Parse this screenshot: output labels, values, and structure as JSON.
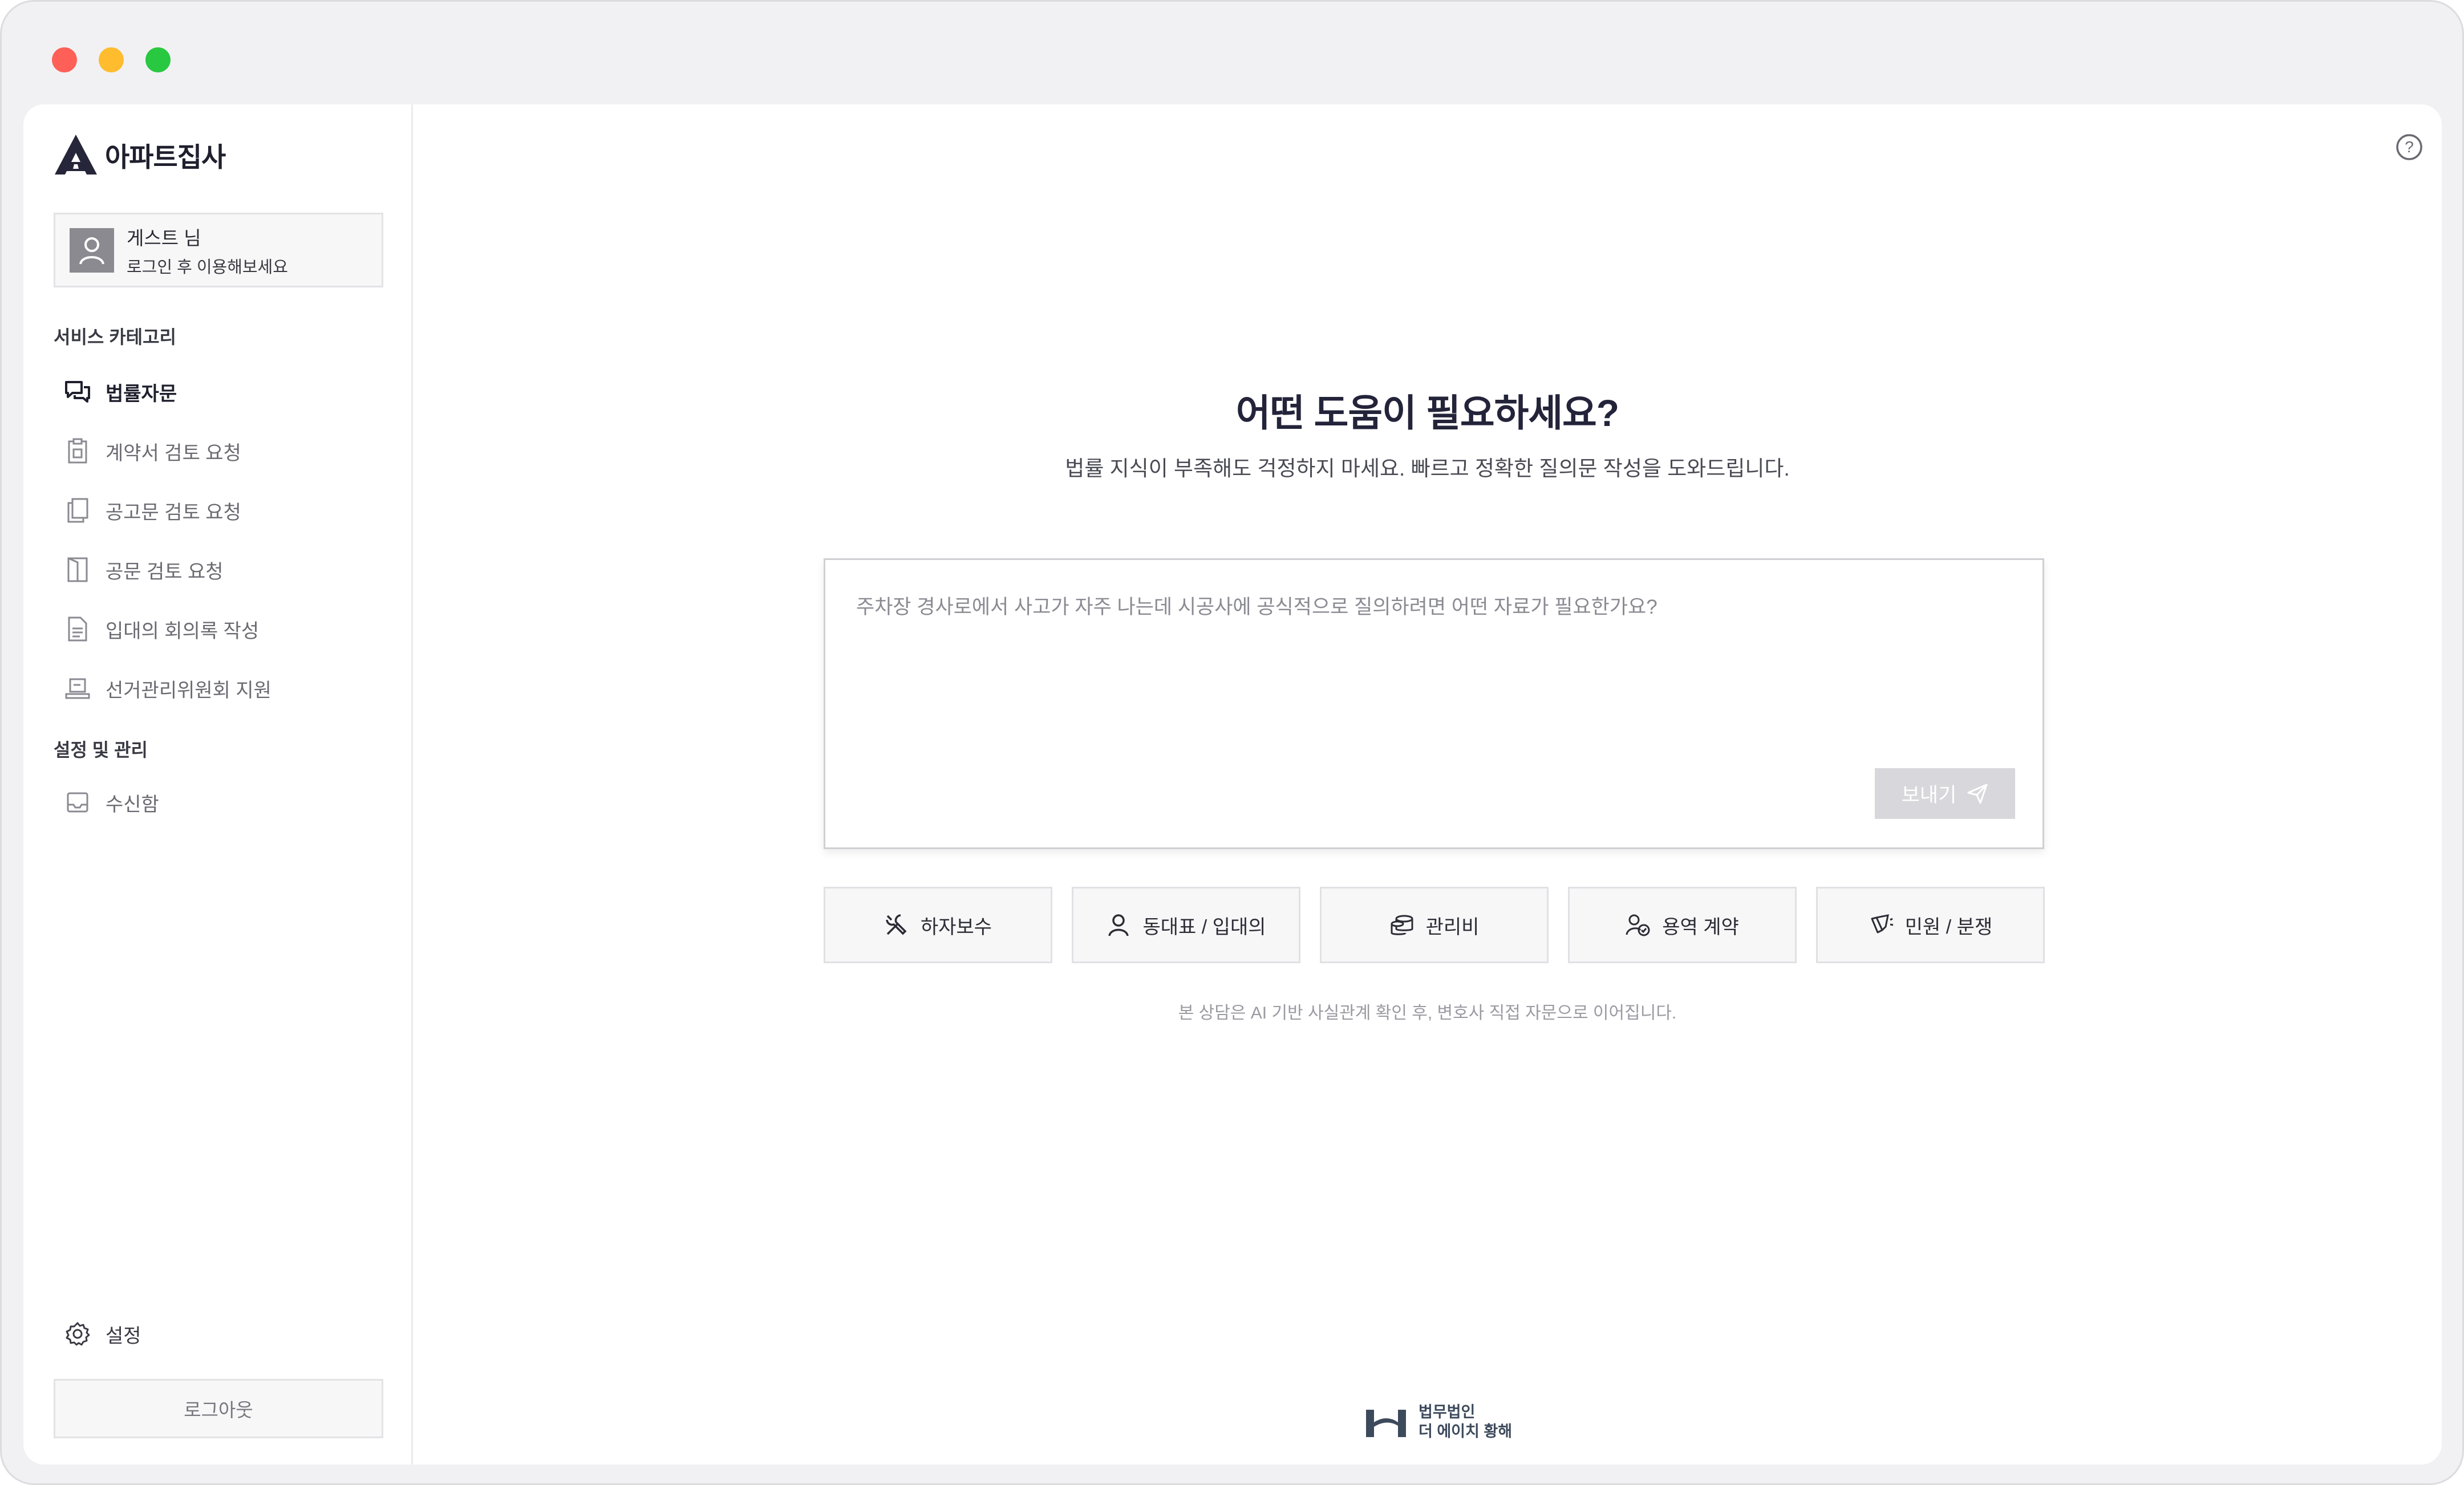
{
  "app": {
    "name": "아파트집사"
  },
  "user": {
    "name": "게스트 님",
    "subtitle": "로그인 후 이용해보세요"
  },
  "sidebar": {
    "section_services": "서비스 카테고리",
    "items": [
      {
        "label": "법률자문",
        "icon": "chat-bubbles-icon",
        "active": true
      },
      {
        "label": "계약서 검토 요청",
        "icon": "clipboard-icon"
      },
      {
        "label": "공고문 검토 요청",
        "icon": "copy-docs-icon"
      },
      {
        "label": "공문 검토 요청",
        "icon": "door-doc-icon"
      },
      {
        "label": "입대의 회의록 작성",
        "icon": "document-icon"
      },
      {
        "label": "선거관리위원회 지원",
        "icon": "ballot-icon"
      }
    ],
    "section_settings": "설정 및 관리",
    "settings_items": [
      {
        "label": "수신함",
        "icon": "inbox-icon"
      }
    ],
    "bottom": {
      "settings_label": "설정",
      "logout_label": "로그아웃"
    }
  },
  "main": {
    "heading": "어떤 도움이 필요하세요?",
    "subheading": "법률 지식이 부족해도 걱정하지 마세요. 빠르고 정확한 질의문 작성을 도와드립니다.",
    "input_placeholder": "주차장 경사로에서 사고가 자주 나는데 시공사에 공식적으로 질의하려면 어떤 자료가 필요한가요?",
    "send_label": "보내기",
    "chips": [
      {
        "label": "하자보수",
        "icon": "tools-icon"
      },
      {
        "label": "동대표 / 입대의",
        "icon": "person-icon"
      },
      {
        "label": "관리비",
        "icon": "coins-icon"
      },
      {
        "label": "용역 계약",
        "icon": "person-contract-icon"
      },
      {
        "label": "민원 / 분쟁",
        "icon": "megaphone-icon"
      }
    ],
    "disclaimer": "본 상담은 AI 기반 사실관계 확인 후, 변호사 직접 자문으로 이어집니다."
  },
  "footer": {
    "line1": "법무법인",
    "line2": "더 에이치 황해"
  },
  "colors": {
    "accent": "#23233a",
    "send_disabled": "#d8d8dc",
    "brand_footer": "#3d4a5c"
  }
}
